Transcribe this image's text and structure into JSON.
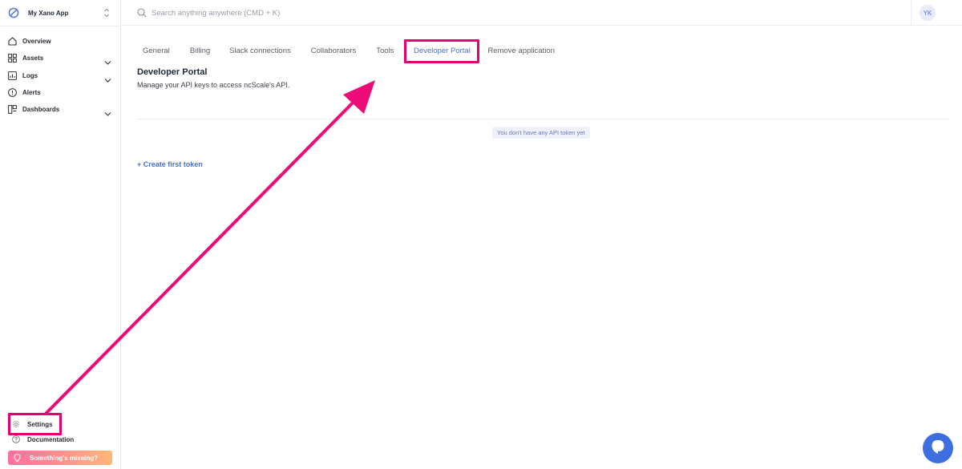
{
  "sidebar": {
    "app_name": "My Xano App",
    "nav": [
      {
        "label": "Overview",
        "icon": "home-icon",
        "has_chevron": false
      },
      {
        "label": "Assets",
        "icon": "grid-icon",
        "has_chevron": true
      },
      {
        "label": "Logs",
        "icon": "chart-icon",
        "has_chevron": true
      },
      {
        "label": "Alerts",
        "icon": "alert-icon",
        "has_chevron": false
      },
      {
        "label": "Dashboards",
        "icon": "dashboard-icon",
        "has_chevron": true
      }
    ],
    "settings_label": "Settings",
    "documentation_label": "Documentation",
    "missing_label": "Something's missing?"
  },
  "topbar": {
    "search_placeholder": "Search anything anywhere (CMD + K)",
    "avatar_initials": "YK"
  },
  "tabs": [
    {
      "label": "General",
      "active": false
    },
    {
      "label": "Billing",
      "active": false
    },
    {
      "label": "Slack connections",
      "active": false
    },
    {
      "label": "Collaborators",
      "active": false
    },
    {
      "label": "Tools",
      "active": false
    },
    {
      "label": "Developer Portal",
      "active": true
    },
    {
      "label": "Remove application",
      "active": false
    }
  ],
  "content": {
    "title": "Developer Portal",
    "subtitle": "Manage your API keys to access ncScale's API.",
    "empty_message": "You don't have any API token yet",
    "create_link": "+ Create first token"
  },
  "colors": {
    "accent": "#4a6fd6",
    "annotation": "#e5006f",
    "chat": "#3d6fe0"
  }
}
